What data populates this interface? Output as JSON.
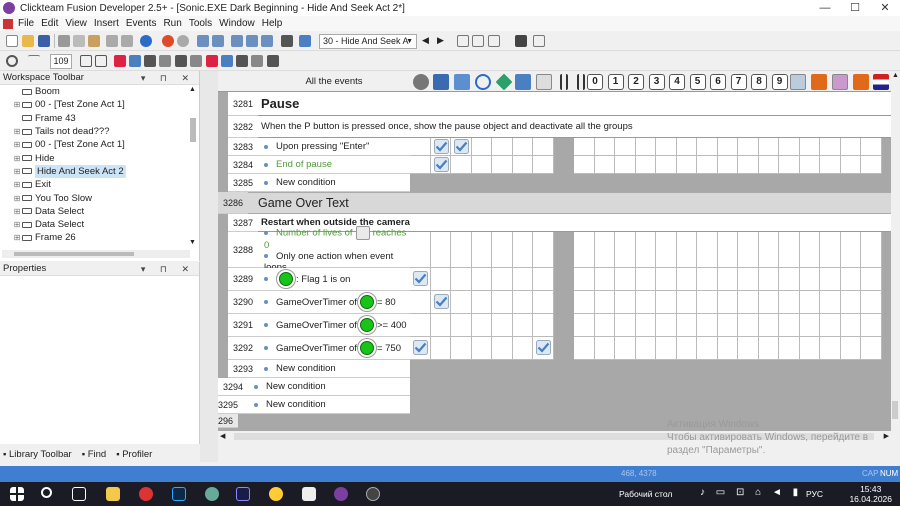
{
  "window": {
    "title": "Clickteam Fusion Developer 2.5+ - [Sonic.EXE Dark Beginning - Hide And Seek Act 2*]"
  },
  "menu": [
    "File",
    "Edit",
    "View",
    "Insert",
    "Events",
    "Run",
    "Tools",
    "Window",
    "Help"
  ],
  "toolbar": {
    "zoom_value": "109",
    "frame_select": "30 - Hide And Seek A"
  },
  "workspace": {
    "title": "Workspace Toolbar",
    "items": [
      "Boom",
      "00 - [Test Zone Act 1]",
      "Frame 43",
      "Tails not dead???",
      "00 - [Test Zone Act 1]",
      "Hide",
      "Hide And Seek Act 2",
      "Exit",
      "You Too Slow",
      "Data Select",
      "Data Select",
      "Frame 26"
    ],
    "selected_index": 6
  },
  "properties": {
    "title": "Properties"
  },
  "bottom_tabs": [
    "Library Toolbar",
    "Find",
    "Profiler"
  ],
  "editor": {
    "all_events_label": "All the events",
    "column_numbers": [
      "0",
      "1",
      "2",
      "3",
      "4",
      "5",
      "6",
      "7",
      "8",
      "9"
    ],
    "rows": [
      {
        "line": "3281",
        "kind": "comment",
        "text": "Pause",
        "big": true
      },
      {
        "line": "3282",
        "kind": "comment",
        "text": "When the P button is pressed once, show the pause object and deactivate all the groups"
      },
      {
        "line": "3283",
        "kind": "cond",
        "text": "Upon pressing \"Enter\"",
        "checks": [
          1,
          2
        ]
      },
      {
        "line": "3284",
        "kind": "cond",
        "text": "End of pause",
        "green": true,
        "checks": [
          1
        ]
      },
      {
        "line": "3285",
        "kind": "new",
        "text": "New condition"
      },
      {
        "line": "3286",
        "kind": "group",
        "text": "Game Over Text"
      },
      {
        "line": "3287",
        "kind": "comment",
        "text": "Restart when outside the camera",
        "bold": true
      },
      {
        "line": "3288",
        "kind": "cond2",
        "prefix": "Number of lives of",
        "suffix": "reaches 0",
        "text2": "Only one action when event loops",
        "checks": []
      },
      {
        "line": "3289",
        "kind": "objcond",
        "prefix": "",
        "suffix": ": Flag 1 is on",
        "checks": [
          0
        ]
      },
      {
        "line": "3290",
        "kind": "objcond",
        "prefix": "GameOverTimer of",
        "suffix": "= 80",
        "checks": [
          1
        ]
      },
      {
        "line": "3291",
        "kind": "objcond",
        "prefix": "GameOverTimer of",
        "suffix": ">= 400",
        "checks": []
      },
      {
        "line": "3292",
        "kind": "objcond",
        "prefix": "GameOverTimer of",
        "suffix": "= 750",
        "checks": [
          0,
          6
        ]
      },
      {
        "line": "3293",
        "kind": "new",
        "text": "New condition"
      },
      {
        "line": "3294",
        "kind": "new2",
        "text": "New condition"
      },
      {
        "line": "3295",
        "kind": "new3",
        "text": "New condition"
      },
      {
        "line": "3296",
        "kind": "end",
        "text": ""
      }
    ]
  },
  "watermark": {
    "line1": "Активация Windows",
    "line2": "Чтобы активировать Windows, перейдите в",
    "line3": "раздел \"Параметры\"."
  },
  "status": {
    "coords": "468, 4378",
    "num": "NUM",
    "cap": "CAP"
  },
  "taskbar": {
    "desktop_label": "Рабочий стол",
    "lang": "РУС",
    "time": "15:43",
    "date": "16.04.2026"
  },
  "colors": {
    "accent": "#3f7ed0",
    "check": "#4a7fc1",
    "object_green": "#18c418"
  }
}
